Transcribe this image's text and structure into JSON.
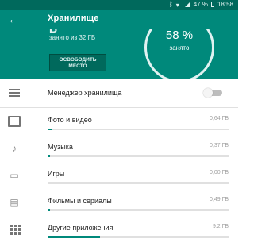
{
  "status_bar": {
    "battery": "47 %",
    "time": "18:58",
    "icons": [
      "bluetooth-icon",
      "wifi-signal-icon",
      "cell-signal-icon",
      "battery-icon"
    ]
  },
  "app_bar": {
    "title": "Хранилище",
    "back_icon": "arrow-back-icon"
  },
  "header": {
    "used_value_partial": "Б",
    "used_text": "занято из 32 ГБ",
    "free_button": "ОСВОБОДИТЬ МЕСТО",
    "percent": "58 %",
    "percent_label": "занято"
  },
  "colors": {
    "primary": "#00897b",
    "primary_dark": "#00695c",
    "text": "#212121",
    "secondary_text": "#9e9e9e"
  },
  "list": {
    "manager": {
      "label": "Менеджер хранилища",
      "icon": "storage-manager-icon",
      "toggle_on": false
    },
    "items": [
      {
        "label": "Фото и видео",
        "size": "0,64 ГБ",
        "icon": "photo-icon",
        "fraction": 0.02
      },
      {
        "label": "Музыка",
        "size": "0,37 ГБ",
        "icon": "music-note-icon",
        "fraction": 0.012
      },
      {
        "label": "Игры",
        "size": "0,00 ГБ",
        "icon": "gamepad-icon",
        "fraction": 0.0
      },
      {
        "label": "Фильмы и сериалы",
        "size": "0,49 ГБ",
        "icon": "film-icon",
        "fraction": 0.015
      },
      {
        "label": "Другие приложения",
        "size": "9,2 ГБ",
        "icon": "apps-icon",
        "fraction": 0.29
      }
    ]
  }
}
